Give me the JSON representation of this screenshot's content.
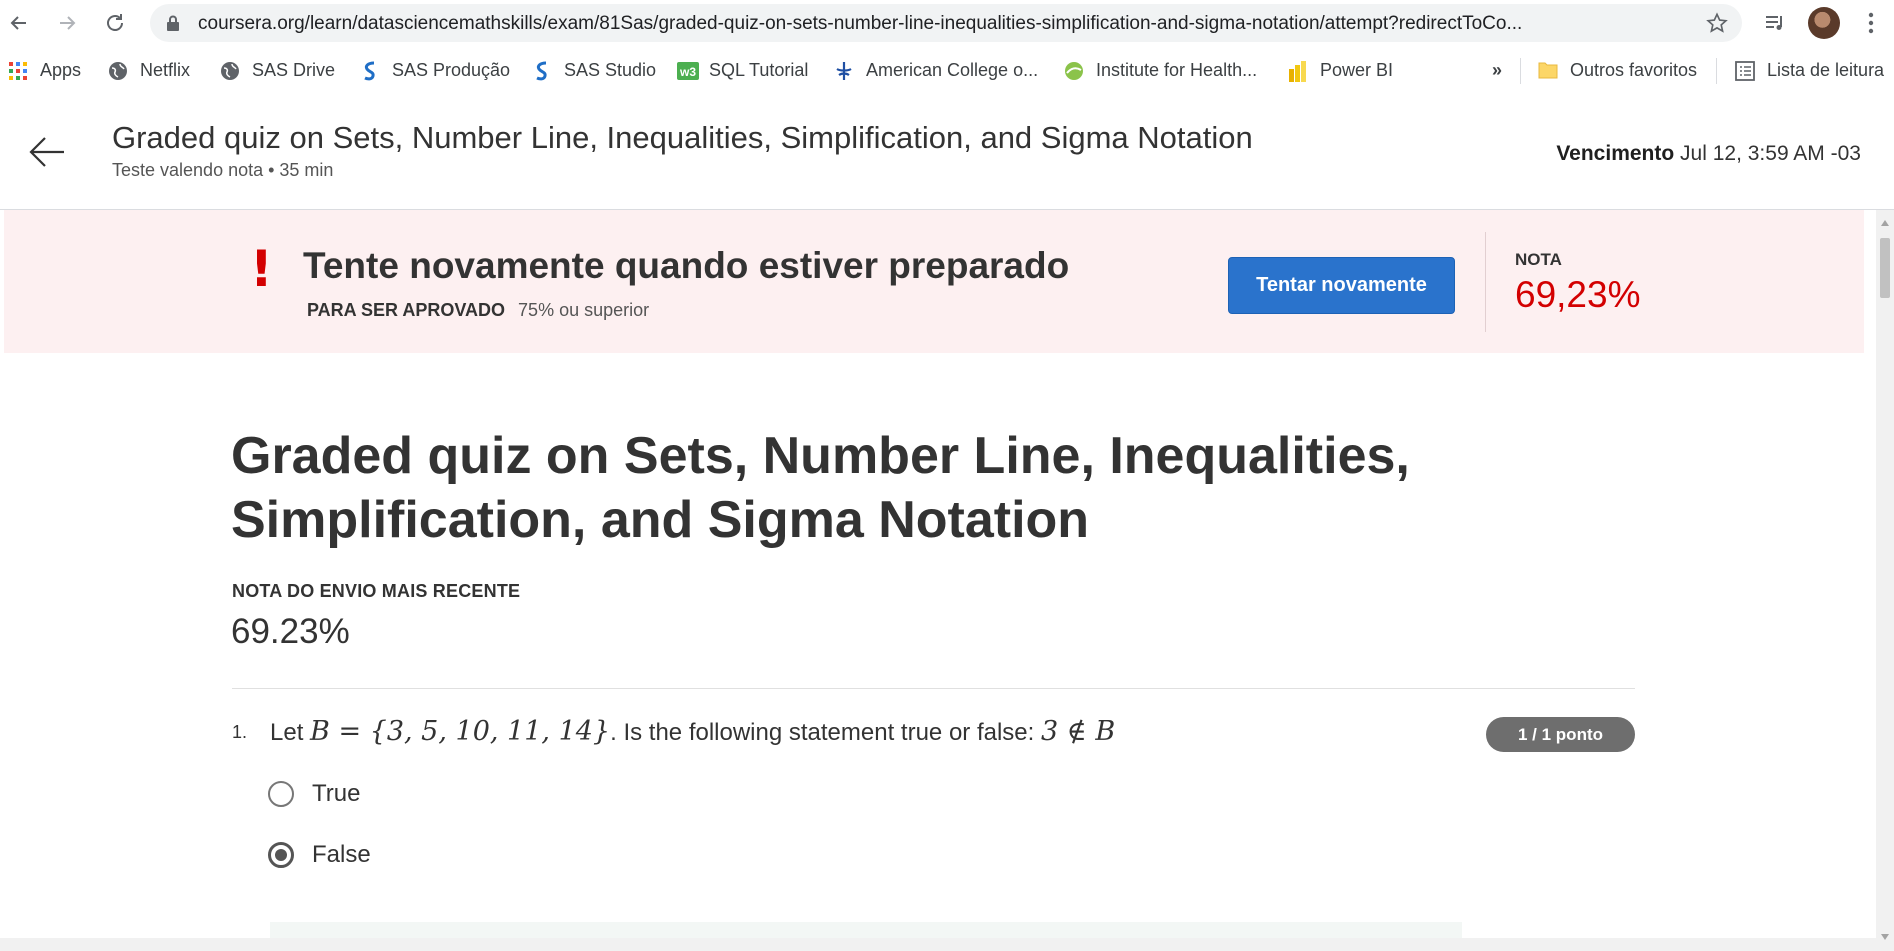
{
  "browser": {
    "url": "coursera.org/learn/datasciencemathskills/exam/81Sas/graded-quiz-on-sets-number-line-inequalities-simplification-and-sigma-notation/attempt?redirectToCo...",
    "bookmarks": [
      {
        "label": "Apps",
        "icon": "apps-grid-icon"
      },
      {
        "label": "Netflix",
        "icon": "globe-icon"
      },
      {
        "label": "SAS Drive",
        "icon": "globe-icon"
      },
      {
        "label": "SAS Produção",
        "icon": "sas-logo-icon"
      },
      {
        "label": "SAS Studio",
        "icon": "sas-logo-icon"
      },
      {
        "label": "SQL Tutorial",
        "icon": "w3schools-icon"
      },
      {
        "label": "American College o...",
        "icon": "acr-logo-icon"
      },
      {
        "label": "Institute for Health...",
        "icon": "globe-green-icon"
      },
      {
        "label": "Power BI",
        "icon": "powerbi-icon"
      }
    ],
    "overflow": "»",
    "other_favorites": "Outros favoritos",
    "reading_list": "Lista de leitura"
  },
  "header": {
    "title": "Graded quiz on Sets, Number Line, Inequalities, Simplification, and Sigma Notation",
    "subtitle": "Teste valendo nota • 35 min",
    "due_label": "Vencimento",
    "due_value": "Jul 12, 3:59 AM -03"
  },
  "banner": {
    "icon": "!",
    "title": "Tente novamente quando estiver preparado",
    "pass_label": "PARA SER APROVADO",
    "pass_value": "75% ou superior",
    "retry_button": "Tentar novamente",
    "grade_label": "NOTA",
    "grade_value": "69,23%",
    "accent_color": "#d30001",
    "button_color": "#2a73cc"
  },
  "main": {
    "quiz_title": "Graded quiz on Sets, Number Line, Inequalities, Simplification, and Sigma Notation",
    "recent_label": "NOTA DO ENVIO MAIS RECENTE",
    "recent_value": "69.23%",
    "questions": [
      {
        "number": "1.",
        "text_prefix": "Let ",
        "math_set": "B = {3, 5, 10, 11, 14}",
        "text_middle": ". Is the following statement true or false: ",
        "math_statement": "3 ∉ B",
        "points": "1 / 1 ponto",
        "options": [
          {
            "label": "True",
            "selected": false
          },
          {
            "label": "False",
            "selected": true
          }
        ]
      }
    ]
  }
}
